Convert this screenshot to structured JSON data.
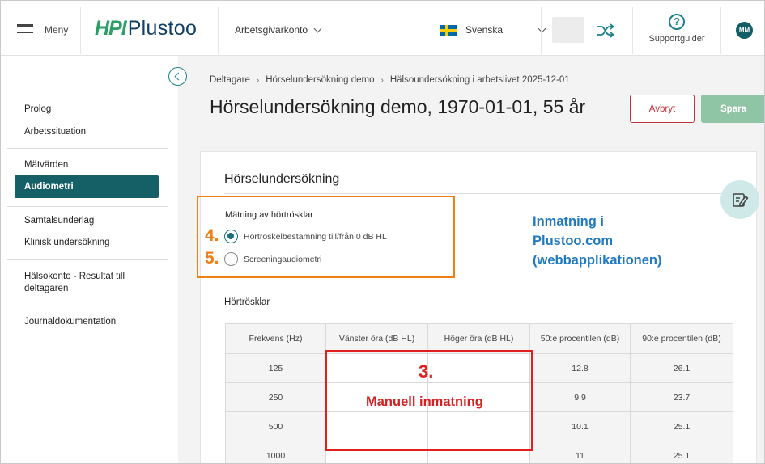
{
  "header": {
    "menu_label": "Meny",
    "logo": {
      "mark": "HPI",
      "name": "Plustoo"
    },
    "account_label": "Arbetsgivarkonto",
    "language_label": "Svenska",
    "support_label": "Supportguider",
    "avatar_initials": "MM",
    "icons": [
      "hamburger-icon",
      "chevron-down-icon",
      "swedish-flag-icon",
      "shuffle-icon",
      "help-circle-icon"
    ]
  },
  "sidebar": {
    "items": [
      {
        "label": "Prolog"
      },
      {
        "label": "Arbetssituation"
      },
      {
        "label": "Mätvärden"
      },
      {
        "label": "Audiometri",
        "active": true
      },
      {
        "label": "Samtalsunderlag"
      },
      {
        "label": "Klinisk undersökning"
      },
      {
        "label": "Hälsokonto - Resultat till deltagaren"
      },
      {
        "label": "Journaldokumentation"
      }
    ]
  },
  "breadcrumb": [
    "Deltagare",
    "Hörselundersökning demo",
    "Hälsoundersökning i arbetslivet 2025-12-01"
  ],
  "page_title": "Hörselundersökning demo, 1970-01-01, 55 år",
  "actions": {
    "cancel": "Avbryt",
    "save": "Spara"
  },
  "section": {
    "title": "Hörselundersökning",
    "measurement_label": "Mätning av hörtrösklar",
    "options": [
      {
        "label": "Hörtröskelbestämning till/från 0 dB HL",
        "checked": true
      },
      {
        "label": "Screeningaudiometri",
        "checked": false
      }
    ],
    "thresholds_label": "Hörtrösklar",
    "table": {
      "headers": [
        "Frekvens (Hz)",
        "Vänster öra (dB HL)",
        "Höger öra (dB HL)",
        "50:e procentilen (dB)",
        "90:e procentilen (dB)"
      ],
      "rows": [
        {
          "freq": "125",
          "left": "",
          "right": "",
          "p50": "12.8",
          "p90": "26.1"
        },
        {
          "freq": "250",
          "left": "",
          "right": "",
          "p50": "9.9",
          "p90": "23.7"
        },
        {
          "freq": "500",
          "left": "",
          "right": "",
          "p50": "10.1",
          "p90": "25.1"
        },
        {
          "freq": "1000",
          "left": "",
          "right": "",
          "p50": "11",
          "p90": "25.1"
        }
      ]
    }
  },
  "annotations": {
    "num4": "4.",
    "num5": "5.",
    "num3": "3.",
    "manual_entry": "Manuell inmatning",
    "web_note": [
      "Inmatning i",
      "Plustoo.com",
      "(webbapplikationen)"
    ],
    "orange": "#f07f16",
    "red": "#e0201f",
    "blue": "#1f7ac2"
  },
  "colors": {
    "teal": "#155f66",
    "save_green": "#8fc4a4",
    "cancel_red": "#c0353c"
  }
}
